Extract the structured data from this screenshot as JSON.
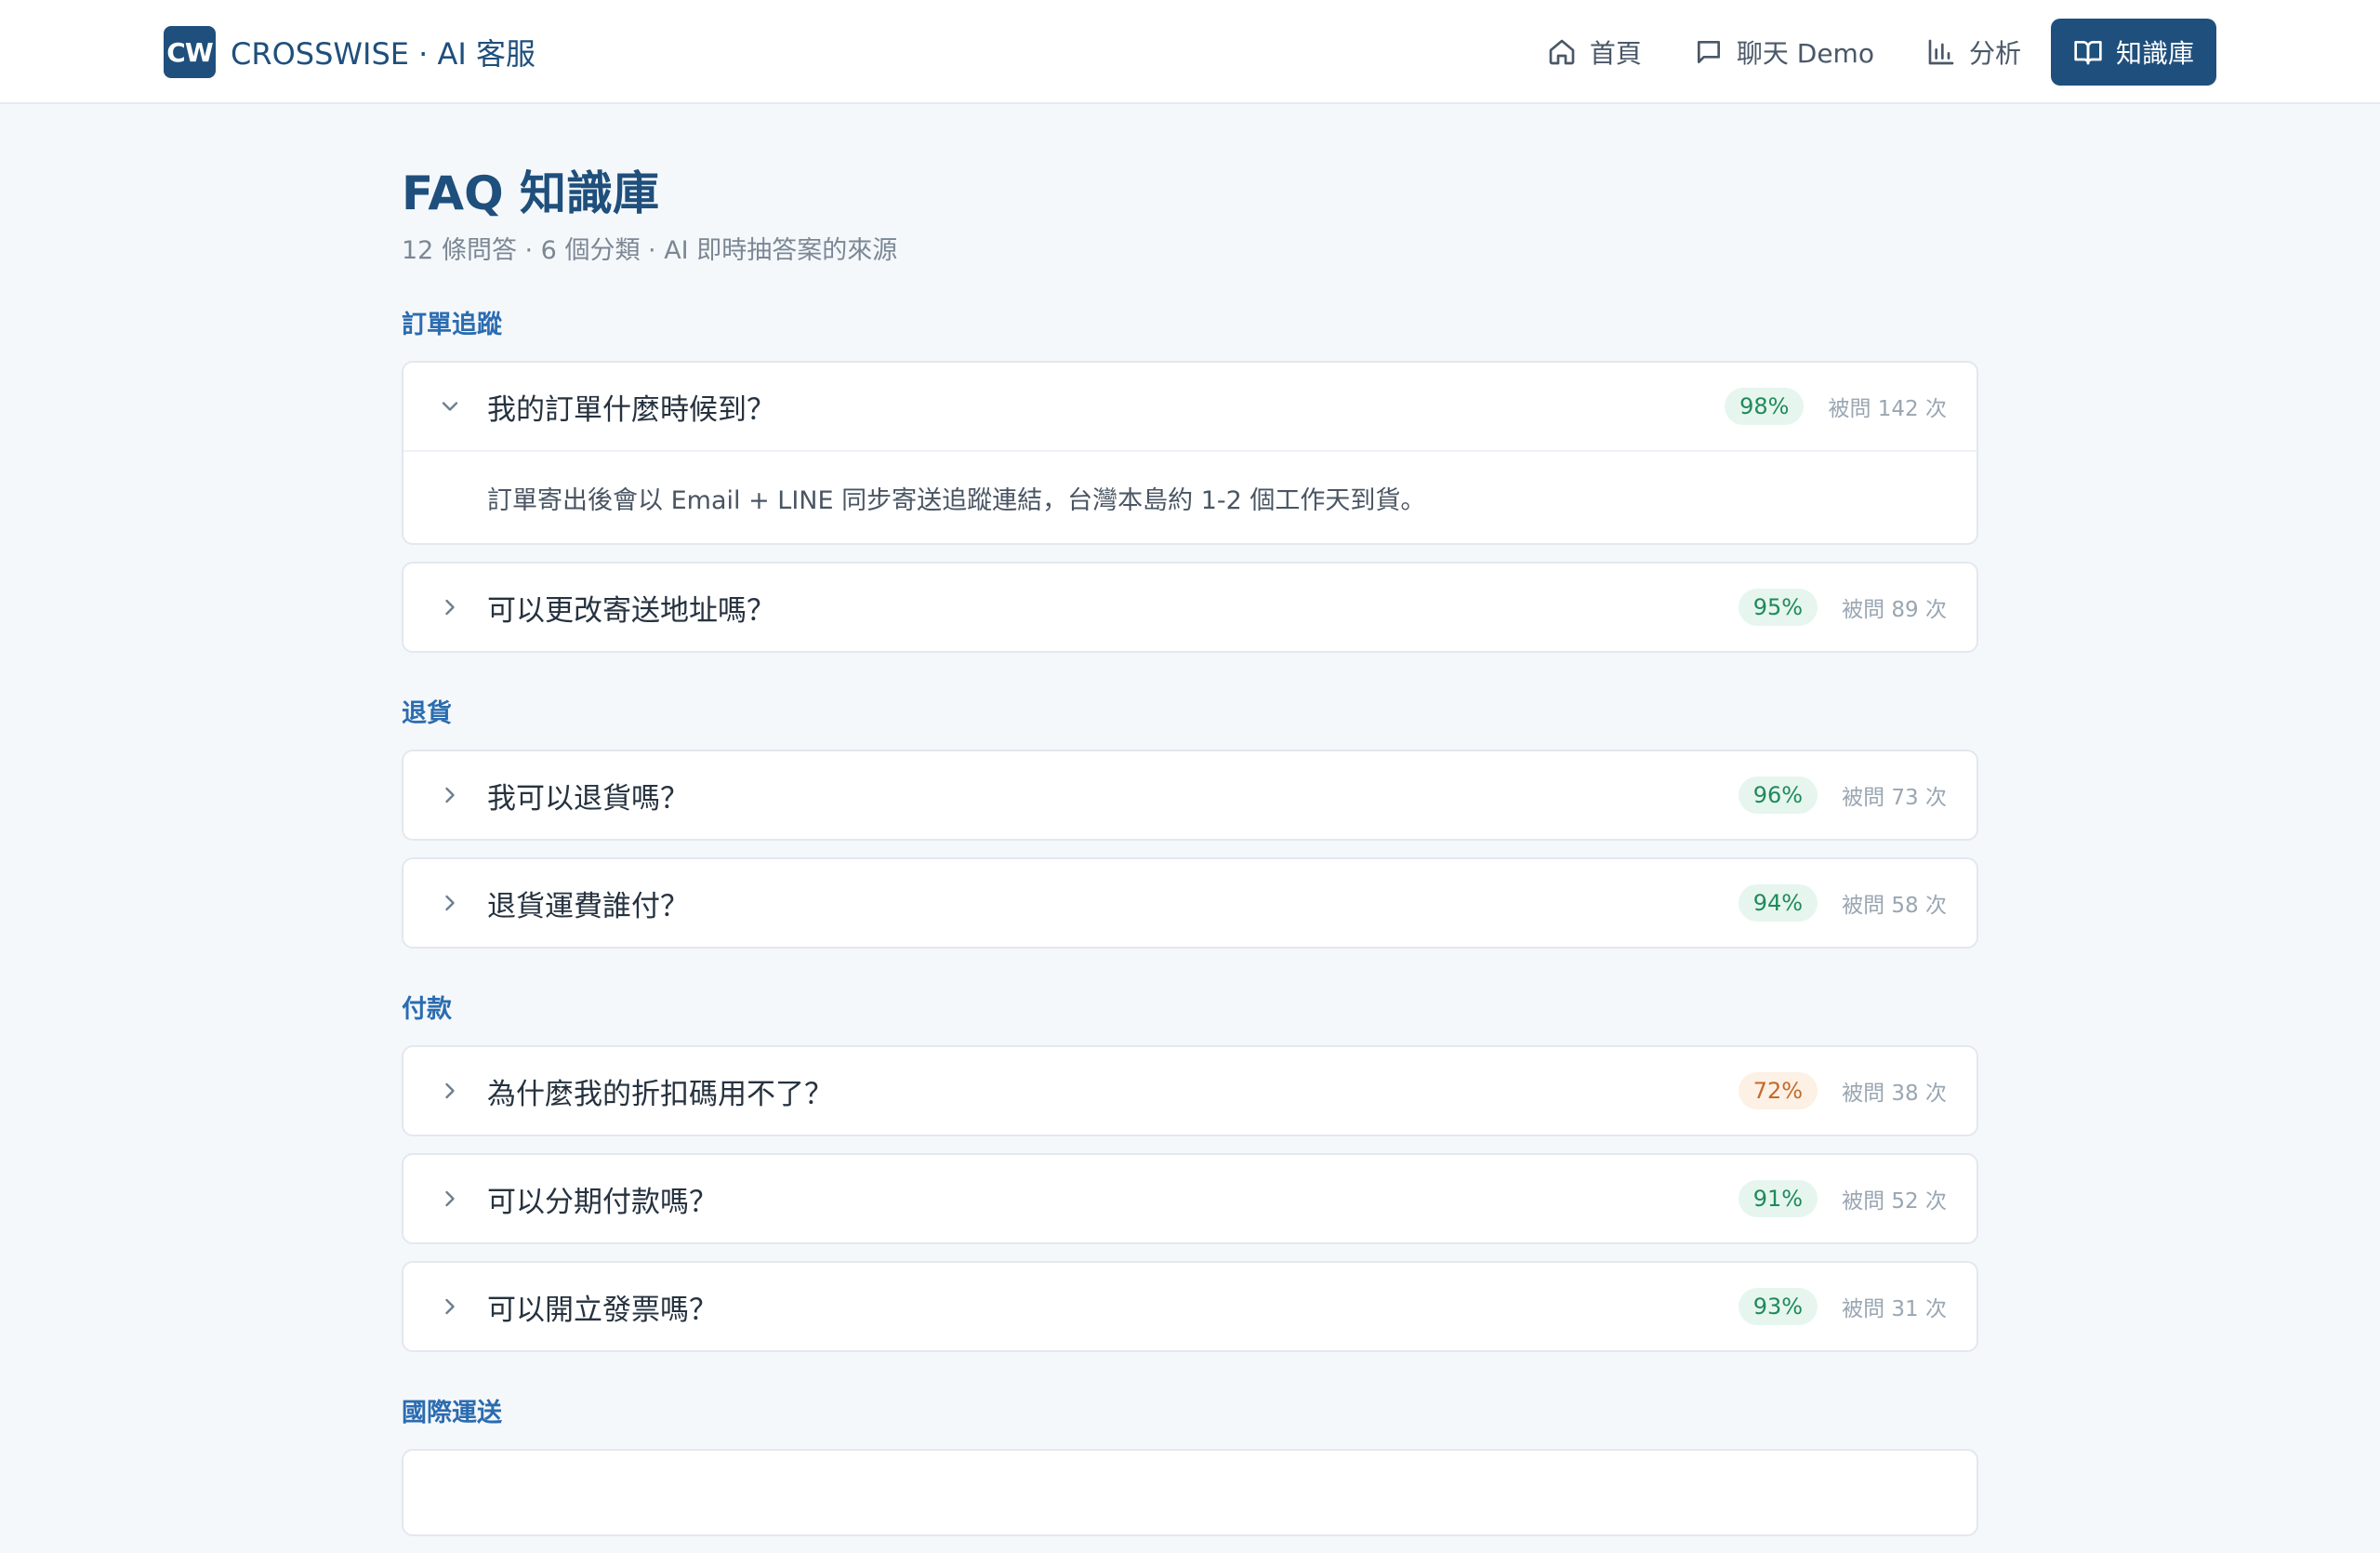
{
  "brand": {
    "logo": "CW",
    "name": "CROSSWISE · AI 客服"
  },
  "nav": {
    "items": [
      {
        "label": "首頁",
        "icon": "home-icon"
      },
      {
        "label": "聊天 Demo",
        "icon": "chat-icon"
      },
      {
        "label": "分析",
        "icon": "bar-chart-icon"
      },
      {
        "label": "知識庫",
        "icon": "book-icon",
        "active": true
      }
    ]
  },
  "page": {
    "title": "FAQ 知識庫",
    "subtitle": "12 條問答 · 6 個分類 · AI 即時抽答案的來源"
  },
  "colors": {
    "brand": "#1f4f7c",
    "category": "#2b6cb0",
    "good_badge_bg": "#e6f6ee",
    "good_badge_text": "#1f8a5a",
    "warn_badge_bg": "#fdf0e4",
    "warn_badge_text": "#c26a2a"
  },
  "categories": [
    {
      "label": "訂單追蹤",
      "faqs": [
        {
          "question": "我的訂單什麼時候到？",
          "confidence": "98%",
          "asked": "被問 142 次",
          "expanded": true,
          "answer": "訂單寄出後會以 Email + LINE 同步寄送追蹤連結，台灣本島約 1-2 個工作天到貨。"
        },
        {
          "question": "可以更改寄送地址嗎？",
          "confidence": "95%",
          "asked": "被問 89 次"
        }
      ]
    },
    {
      "label": "退貨",
      "faqs": [
        {
          "question": "我可以退貨嗎？",
          "confidence": "96%",
          "asked": "被問 73 次"
        },
        {
          "question": "退貨運費誰付？",
          "confidence": "94%",
          "asked": "被問 58 次"
        }
      ]
    },
    {
      "label": "付款",
      "faqs": [
        {
          "question": "為什麼我的折扣碼用不了？",
          "confidence": "72%",
          "asked": "被問 38 次",
          "warn": true
        },
        {
          "question": "可以分期付款嗎？",
          "confidence": "91%",
          "asked": "被問 52 次"
        },
        {
          "question": "可以開立發票嗎？",
          "confidence": "93%",
          "asked": "被問 31 次"
        }
      ]
    },
    {
      "label": "國際運送",
      "faqs": []
    }
  ]
}
